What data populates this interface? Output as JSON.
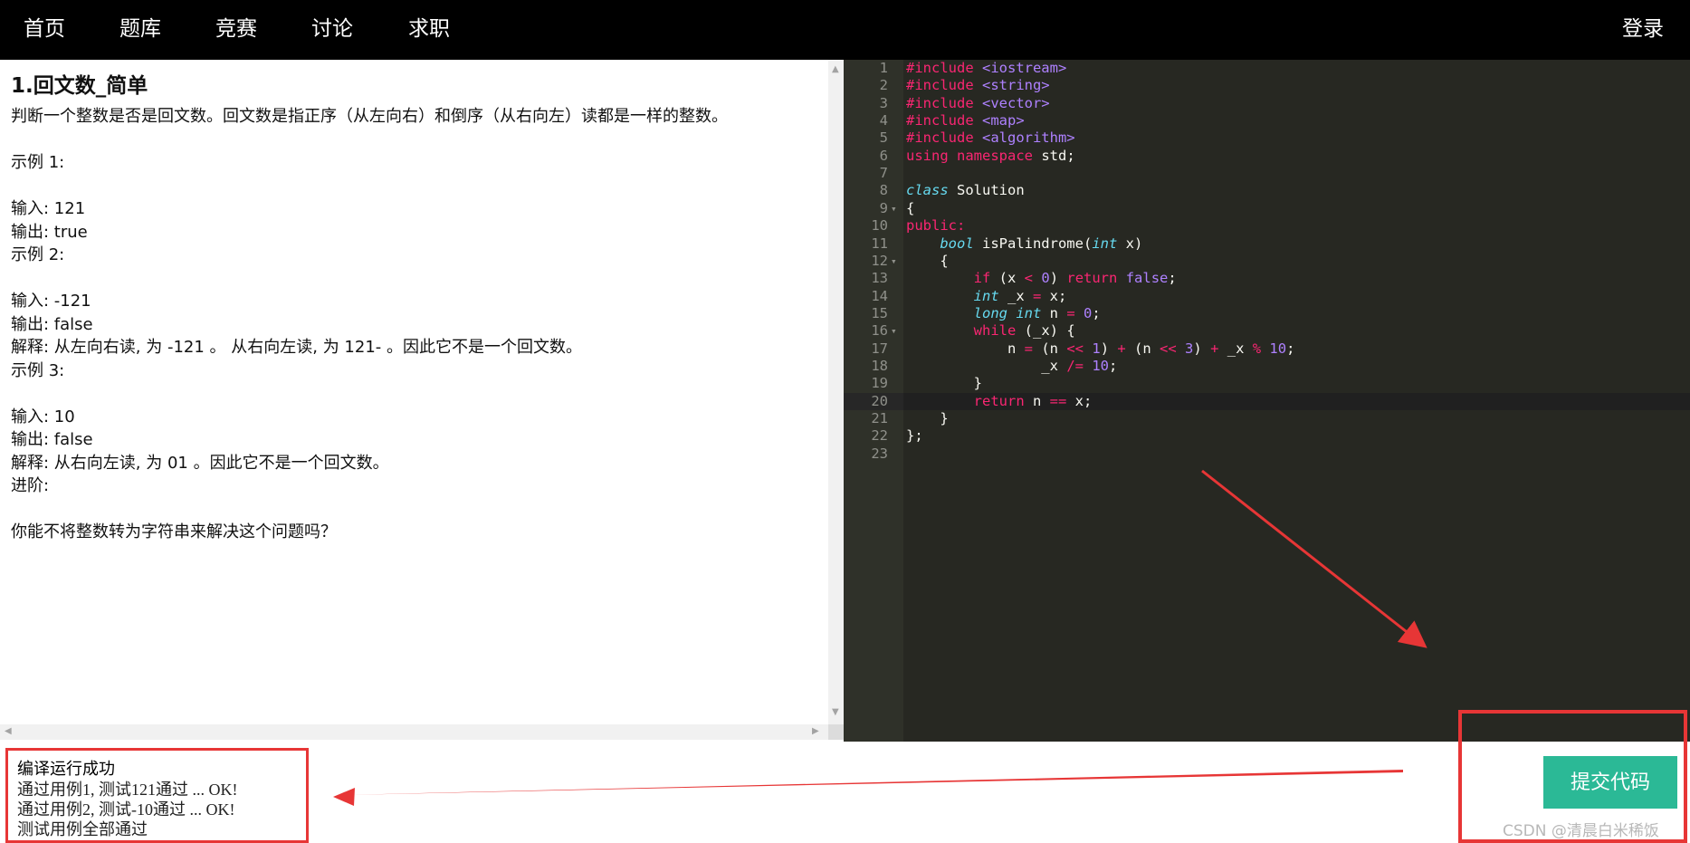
{
  "nav": {
    "items": [
      {
        "label": "首页"
      },
      {
        "label": "题库"
      },
      {
        "label": "竞赛"
      },
      {
        "label": "讨论"
      },
      {
        "label": "求职"
      }
    ],
    "login": "登录"
  },
  "problem": {
    "title": "1.回文数_简单",
    "lines": [
      "判断一个整数是否是回文数。回文数是指正序（从左向右）和倒序（从右向左）读都是一样的整数。",
      "",
      "示例 1:",
      "",
      "输入: 121",
      "输出: true",
      "示例 2:",
      "",
      "输入: -121",
      "输出: false",
      "解释: 从左向右读, 为 -121 。 从右向左读, 为 121- 。因此它不是一个回文数。",
      "示例 3:",
      "",
      "输入: 10",
      "输出: false",
      "解释: 从右向左读, 为 01 。因此它不是一个回文数。",
      "进阶:",
      "",
      "你能不将整数转为字符串来解决这个问题吗？"
    ]
  },
  "editor": {
    "active_line": 20,
    "colors": {
      "background": "#272822",
      "keyword": "#f92672",
      "type": "#66d9ef",
      "number": "#ae81ff"
    },
    "lines": [
      "#include <iostream>",
      "#include <string>",
      "#include <vector>",
      "#include <map>",
      "#include <algorithm>",
      "using namespace std;",
      "",
      "class Solution",
      "{",
      "public:",
      "    bool isPalindrome(int x)",
      "    {",
      "        if (x < 0) return false;",
      "        int _x = x;",
      "        long int n = 0;",
      "        while (_x) {",
      "            n = (n << 1) + (n << 3) + _x % 10;",
      "                _x /= 10;",
      "        }",
      "        return n == x;",
      "    }",
      "};",
      ""
    ],
    "fold_lines": [
      9,
      12,
      16
    ]
  },
  "output": {
    "title": "编译运行成功",
    "lines": [
      "通过用例1, 测试121通过 ... OK!",
      "通过用例2, 测试-10通过 ... OK!",
      "测试用例全部通过"
    ]
  },
  "submit_label": "提交代码",
  "watermark": "CSDN @清晨白米稀饭",
  "accent_colors": {
    "submit": "#2bb996",
    "annotation": "#e73636"
  }
}
